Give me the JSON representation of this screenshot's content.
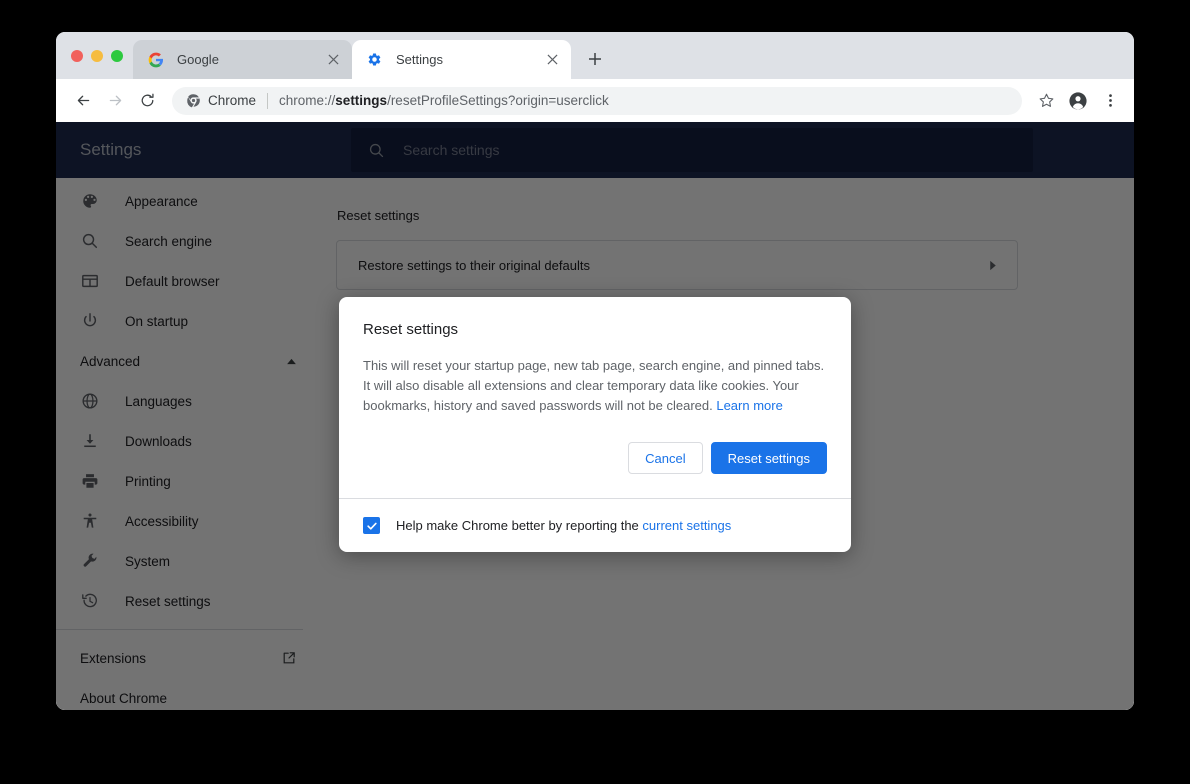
{
  "window": {
    "traffic_lights": [
      "close",
      "minimize",
      "maximize"
    ]
  },
  "tabs": [
    {
      "title": "Google",
      "favicon": "google-icon",
      "active": false,
      "close_label": "×"
    },
    {
      "title": "Settings",
      "favicon": "gear-icon",
      "active": true,
      "close_label": "×"
    }
  ],
  "new_tab_label": "+",
  "toolbar": {
    "back_icon": "back-arrow-icon",
    "forward_icon": "forward-arrow-icon",
    "reload_icon": "reload-icon",
    "chrome_chip_label": "Chrome",
    "url_prefix": "chrome://",
    "url_bold": "settings",
    "url_suffix": "/resetProfileSettings?origin=userclick",
    "bookmark_icon": "star-icon",
    "profile_icon": "account-avatar-icon",
    "menu_icon": "three-dot-menu-icon"
  },
  "settings_header": {
    "title": "Settings",
    "search_placeholder": "Search settings",
    "search_value": "",
    "search_icon": "search-icon",
    "background": "#1d2b50"
  },
  "sidebar": {
    "items": [
      {
        "label": "Appearance",
        "icon": "palette-icon"
      },
      {
        "label": "Search engine",
        "icon": "search-icon"
      },
      {
        "label": "Default browser",
        "icon": "browser-window-icon"
      },
      {
        "label": "On startup",
        "icon": "power-icon"
      }
    ],
    "section": {
      "label": "Advanced",
      "arrow": "chevron-up-icon",
      "expanded": true
    },
    "advanced_items": [
      {
        "label": "Languages",
        "icon": "globe-icon"
      },
      {
        "label": "Downloads",
        "icon": "download-icon"
      },
      {
        "label": "Printing",
        "icon": "printer-icon"
      },
      {
        "label": "Accessibility",
        "icon": "accessibility-icon"
      },
      {
        "label": "System",
        "icon": "wrench-icon"
      },
      {
        "label": "Reset settings",
        "icon": "history-restore-icon"
      }
    ],
    "footer_items": [
      {
        "label": "Extensions",
        "icon": "external-link-icon"
      },
      {
        "label": "About Chrome",
        "icon": ""
      }
    ]
  },
  "main": {
    "section_heading": "Reset settings",
    "card_label": "Restore settings to their original defaults",
    "card_arrow": "chevron-right-icon"
  },
  "dialog": {
    "title": "Reset settings",
    "body_text": "This will reset your startup page, new tab page, search engine, and pinned tabs. It will also disable all extensions and clear temporary data like cookies. Your bookmarks, history and saved passwords will not be cleared. ",
    "learn_more": "Learn more",
    "cancel_label": "Cancel",
    "confirm_label": "Reset settings",
    "footer_text_before": "Help make Chrome better by reporting the ",
    "footer_link": "current settings",
    "checkbox_checked": true
  },
  "colors": {
    "accent_blue": "#1a73e8",
    "header_navy": "#1d2b50",
    "search_navy": "#162140",
    "tab_strip": "#dee1e6",
    "scrim": "rgba(0,0,0,0.55)"
  }
}
